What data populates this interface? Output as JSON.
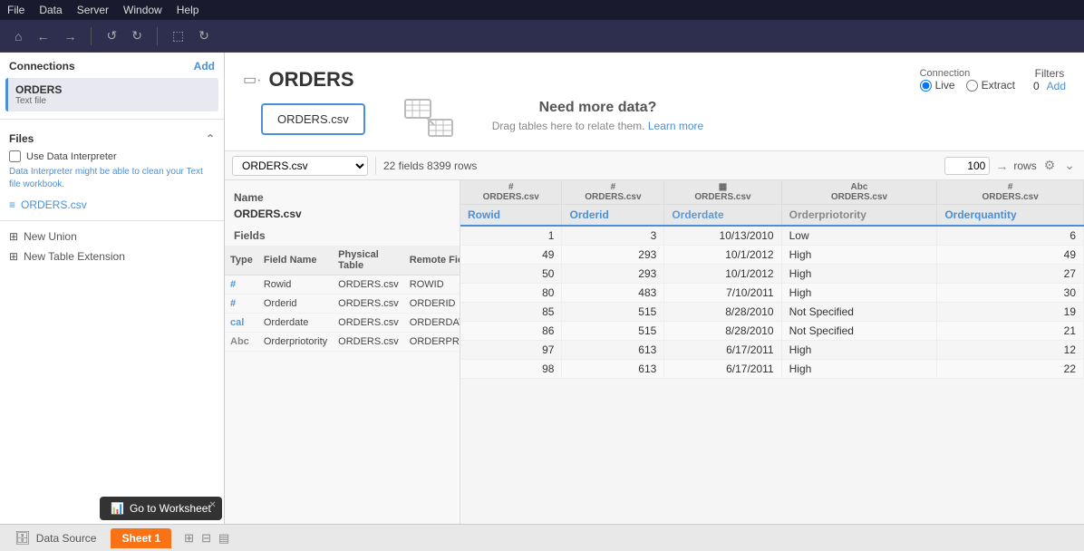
{
  "menubar": {
    "items": [
      "File",
      "Data",
      "Server",
      "Window",
      "Help"
    ]
  },
  "toolbar": {
    "buttons": [
      "⌂",
      "←",
      "→",
      "↺↺",
      "⬚",
      "↻"
    ]
  },
  "left_panel": {
    "connections_label": "Connections",
    "add_label": "Add",
    "connection": {
      "name": "ORDERS",
      "type": "Text file"
    },
    "files_label": "Files",
    "use_data_interpreter": "Use Data Interpreter",
    "interpreter_note": "Data Interpreter might be able to clean your Text file workbook.",
    "file_item": "ORDERS.csv",
    "new_union": "New Union",
    "new_table_extension": "New Table Extension"
  },
  "canvas": {
    "page_title": "ORDERS",
    "connection_label": "Connection",
    "live_label": "Live",
    "extract_label": "Extract",
    "filters_label": "Filters",
    "filters_count": "0",
    "filters_add": "Add",
    "table_card": "ORDERS.csv",
    "drag_title": "Need more data?",
    "drag_subtitle": "Drag tables here to relate them.",
    "drag_learn_more": "Learn more"
  },
  "grid_toolbar": {
    "select_value": "ORDERS.csv",
    "fields_rows_info": "22 fields 8399 rows",
    "rows_value": "100",
    "rows_label": "rows"
  },
  "data_panel": {
    "name_label": "Name",
    "name_value": "ORDERS.csv",
    "fields_label": "Fields",
    "columns": [
      "Type",
      "Field Name",
      "Physical Table",
      "Remote Fiel..."
    ],
    "rows": [
      {
        "type": "#",
        "type_class": "num",
        "field_name": "Rowid",
        "physical": "ORDERS.csv",
        "remote": "ROWID"
      },
      {
        "type": "#",
        "type_class": "num",
        "field_name": "Orderid",
        "physical": "ORDERS.csv",
        "remote": "ORDERID"
      },
      {
        "type": "cal",
        "type_class": "date",
        "field_name": "Orderdate",
        "physical": "ORDERS.csv",
        "remote": "ORDERDATE"
      },
      {
        "type": "Abc",
        "type_class": "str",
        "field_name": "Orderpriotority",
        "physical": "ORDERS.csv",
        "remote": "ORDERPRIOT..."
      }
    ]
  },
  "data_table": {
    "columns": [
      {
        "source": "ORDERS.csv",
        "name": "Rowid",
        "type": "num"
      },
      {
        "source": "ORDERS.csv",
        "name": "Orderid",
        "type": "num"
      },
      {
        "source": "ORDERS.csv",
        "name": "Orderdate",
        "type": "date"
      },
      {
        "source": "ORDERS.csv",
        "name": "Orderpriotority",
        "type": "str"
      },
      {
        "source": "ORDERS.csv",
        "name": "Orderquantity",
        "type": "num"
      }
    ],
    "rows": [
      [
        1,
        3,
        "10/13/2010",
        "Low",
        6
      ],
      [
        49,
        293,
        "10/1/2012",
        "High",
        49
      ],
      [
        50,
        293,
        "10/1/2012",
        "High",
        27
      ],
      [
        80,
        483,
        "7/10/2011",
        "High",
        30
      ],
      [
        85,
        515,
        "8/28/2010",
        "Not Specified",
        19
      ],
      [
        86,
        515,
        "8/28/2010",
        "Not Specified",
        21
      ],
      [
        97,
        613,
        "6/17/2011",
        "High",
        12
      ],
      [
        98,
        613,
        "6/17/2011",
        "High",
        22
      ]
    ]
  },
  "bottom_bar": {
    "datasource_label": "Data Source",
    "sheet_label": "Sheet 1",
    "goto_worksheet_label": "Go to Worksheet"
  }
}
